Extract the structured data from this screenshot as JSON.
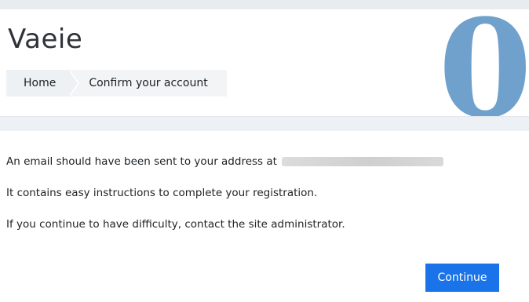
{
  "site": {
    "title": "Vaeie",
    "badge_digit": "0"
  },
  "breadcrumb": {
    "home_label": "Home",
    "current_label": "Confirm your account"
  },
  "main": {
    "line1": "An email should have been sent to your address at",
    "line2": "It contains easy instructions to complete your registration.",
    "line3": "If you continue to have difficulty, contact the site administrator.",
    "continue_label": "Continue"
  },
  "colors": {
    "accent": "#1a73e8",
    "badge": "#6fa1cc"
  }
}
